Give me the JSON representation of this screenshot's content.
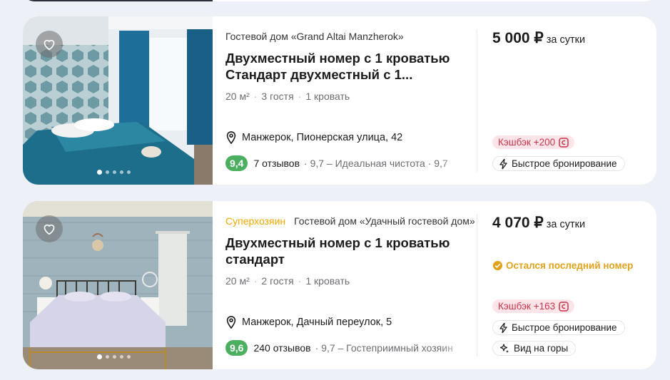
{
  "listings": [
    {
      "host": "Гостевой дом «Grand Altai Manzherok»",
      "superhost": "",
      "title": "Двухместный номер с 1 кроватью Стандарт двухместный с 1...",
      "specs": [
        "20 м²",
        "3 гостя",
        "1 кровать"
      ],
      "address": "Манжерок, Пионерская улица, 42",
      "score": "9,4",
      "reviews": "7 отзывов",
      "review_tags": "9,7 – Идеальная чистота · 9,7",
      "price": "5 000 ₽",
      "price_unit": "за сутки",
      "availability": "",
      "cashback": "Кэшбэк +200",
      "badges": [
        {
          "icon": "lightning-icon",
          "label": "Быстрое бронирование"
        }
      ],
      "photo_dots": 5,
      "active_dot": 0
    },
    {
      "host": "Гостевой дом «Удачный гостевой дом»",
      "superhost": "Суперхозяин",
      "title": "Двухместный номер с 1 кроватью стандарт",
      "specs": [
        "20 м²",
        "2 гостя",
        "1 кровать"
      ],
      "address": "Манжерок, Дачный переулок, 5",
      "score": "9,6",
      "reviews": "240 отзывов",
      "review_tags": "9,7 – Гостеприимный хозяин",
      "price": "4 070 ₽",
      "price_unit": "за сутки",
      "availability": "Остался последний номер",
      "cashback": "Кэшбэк +163",
      "badges": [
        {
          "icon": "lightning-icon",
          "label": "Быстрое бронирование"
        },
        {
          "icon": "sparkle-icon",
          "label": "Вид на горы"
        }
      ],
      "photo_dots": 5,
      "active_dot": 0
    }
  ],
  "colors": {
    "superhost": "#f0a800",
    "score_green": "#4caf60",
    "cashback_bg": "#fde4e8",
    "cashback_text": "#c7344b",
    "availability": "#e0a21b",
    "page_bg": "#eef0f8"
  }
}
